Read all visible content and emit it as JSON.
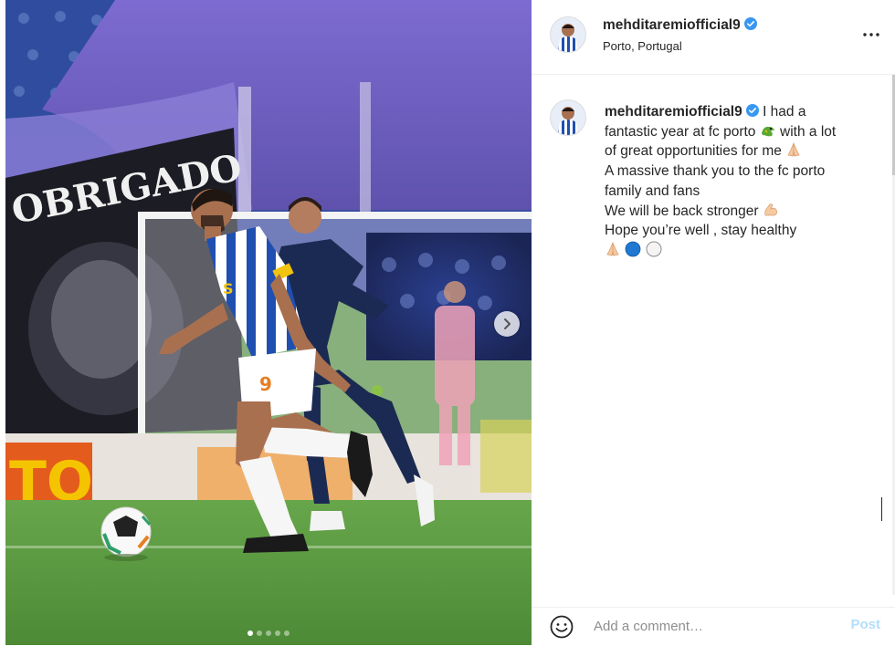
{
  "post": {
    "media": {
      "banner_text": "OBRIGADO",
      "ad_board_text": "TO",
      "carousel_count": 5,
      "carousel_active": 1
    },
    "header": {
      "username": "mehditaremiofficial9",
      "location": "Porto, Portugal",
      "more_icon": "ellipsis-icon"
    },
    "caption": {
      "username": "mehditaremiofficial9",
      "line1": "I had a",
      "line2": "fantastic year at fc porto",
      "line2b": "with a lot",
      "line3": "of great opportunities for me",
      "line4": "A massive thank you to the fc porto",
      "line5": "family and fans",
      "line6": "We will be back stronger",
      "line7": "Hope you’re well , stay healthy"
    },
    "comment": {
      "placeholder": "Add a comment…",
      "value": "",
      "post_label": "Post"
    },
    "colors": {
      "verified": "#3897f0",
      "post_disabled": "#b2dffc",
      "porto_blue": "#1f4fb0",
      "pitch_green": "#5f9a45"
    }
  }
}
